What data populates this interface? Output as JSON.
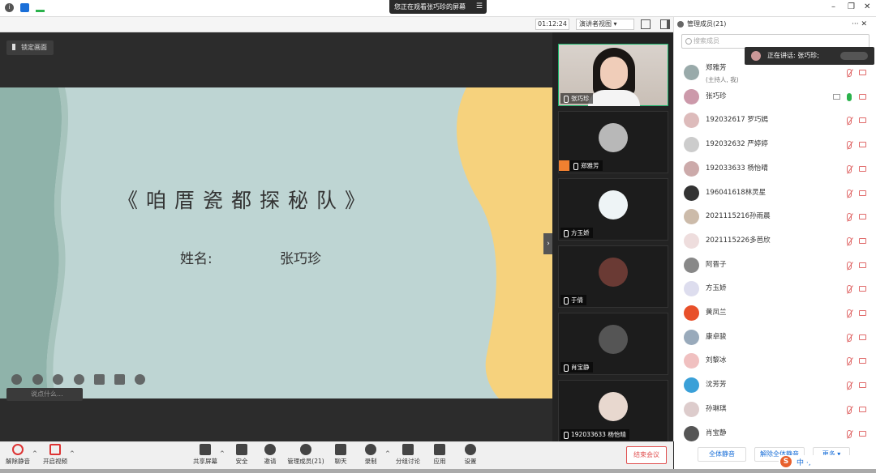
{
  "banner": {
    "text": "您正在观看张巧珍的屏幕",
    "menu_icon": "menu-icon"
  },
  "toolbar": {
    "timer": "01:12:24",
    "view_mode": "演讲者视图 ▾"
  },
  "stage": {
    "lock_label": "锁定画面"
  },
  "slide": {
    "title": "《咱厝瓷都探秘队》",
    "name_label": "姓名:",
    "name_value": "张巧珍"
  },
  "chat": {
    "placeholder": "说点什么..."
  },
  "videos": [
    {
      "name": "张巧珍",
      "active": true
    },
    {
      "name": "郑雅芳",
      "active": false
    },
    {
      "name": "方玉娇",
      "active": false
    },
    {
      "name": "于倩",
      "active": false
    },
    {
      "name": "肖宝静",
      "active": false
    },
    {
      "name": "192033633 杨怡晴",
      "active": false
    }
  ],
  "sidebar": {
    "header": "管理成员(21)",
    "search_placeholder": "搜索成员",
    "speaking": "正在讲话: 张巧珍;",
    "members": [
      {
        "name": "郑雅芳",
        "sub": "(主持人, 我)"
      },
      {
        "name": "张巧珍",
        "sub": ""
      },
      {
        "name": "192032617 罗巧嫣",
        "sub": ""
      },
      {
        "name": "192032632 严婷婷",
        "sub": ""
      },
      {
        "name": "192033633 杨怡晴",
        "sub": ""
      },
      {
        "name": "196041618林灵星",
        "sub": ""
      },
      {
        "name": "2021115216孙雨晨",
        "sub": ""
      },
      {
        "name": "2021115226多芭欣",
        "sub": ""
      },
      {
        "name": "阿晋子",
        "sub": ""
      },
      {
        "name": "方玉娇",
        "sub": ""
      },
      {
        "name": "黄凤兰",
        "sub": ""
      },
      {
        "name": "康卓骏",
        "sub": ""
      },
      {
        "name": "刘黎冰",
        "sub": ""
      },
      {
        "name": "沈芳芳",
        "sub": ""
      },
      {
        "name": "孙琳琪",
        "sub": ""
      },
      {
        "name": "肖宝静",
        "sub": ""
      }
    ],
    "mute_all": "全体静音",
    "unmute_all": "解除全体静音",
    "more": "更多 ▾"
  },
  "bottom": {
    "unmute": "解除静音",
    "video": "开启视频",
    "share": "共享屏幕",
    "security": "安全",
    "invite": "邀请",
    "members": "管理成员(21)",
    "chat": "聊天",
    "record": "录制",
    "breakout": "分组讨论",
    "apps": "应用",
    "settings": "设置",
    "end": "结束会议"
  },
  "ime": {
    "label": "中 ·,"
  }
}
